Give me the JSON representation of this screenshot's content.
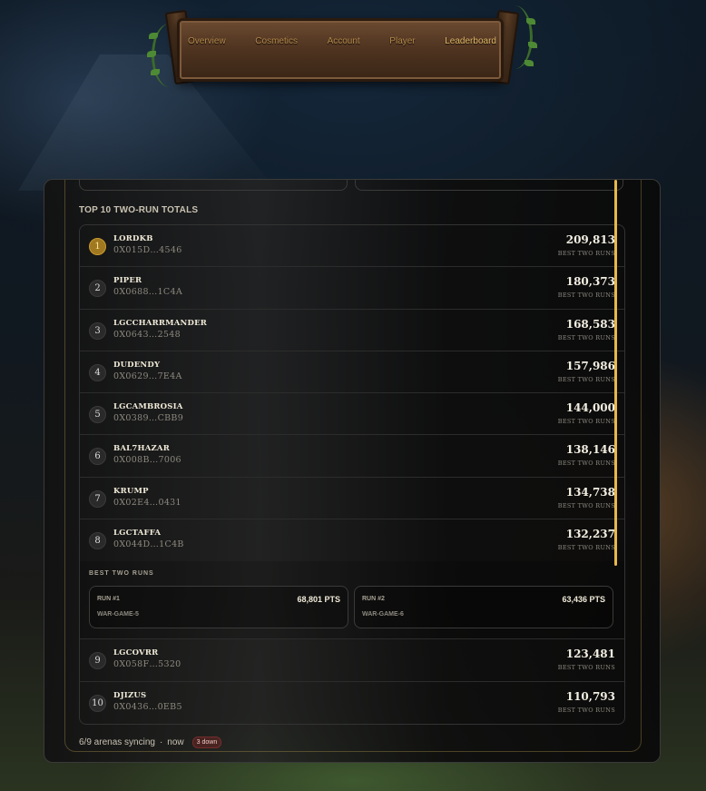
{
  "nav": {
    "items": [
      {
        "label": "Overview",
        "active": false
      },
      {
        "label": "Cosmetics",
        "active": false
      },
      {
        "label": "Account",
        "active": false
      },
      {
        "label": "Player",
        "active": false
      },
      {
        "label": "Leaderboard",
        "active": true
      }
    ]
  },
  "leaderboard": {
    "title": "TOP 10 TWO-RUN TOTALS",
    "caption": "BEST TWO RUNS",
    "rows_top": [
      {
        "rank": "1",
        "name": "LORDKB",
        "address": "0X015D…4546",
        "score": "209,813"
      },
      {
        "rank": "2",
        "name": "PIPER",
        "address": "0X0688…1C4A",
        "score": "180,373"
      },
      {
        "rank": "3",
        "name": "LGCCHARRMANDER",
        "address": "0X0643…2548",
        "score": "168,583"
      },
      {
        "rank": "4",
        "name": "DUDENDY",
        "address": "0X0629…7E4A",
        "score": "157,986"
      },
      {
        "rank": "5",
        "name": "LGCAMBROSIA",
        "address": "0X0389…CBB9",
        "score": "144,000"
      },
      {
        "rank": "6",
        "name": "BAL7HAZAR",
        "address": "0X008B…7006",
        "score": "138,146"
      },
      {
        "rank": "7",
        "name": "KRUMP",
        "address": "0X02E4…0431",
        "score": "134,738"
      },
      {
        "rank": "8",
        "name": "LGCTAFFA",
        "address": "0X044D…1C4B",
        "score": "132,237"
      }
    ],
    "expanded": {
      "title": "BEST TWO RUNS",
      "runs": [
        {
          "label": "RUN #1",
          "points": "68,801 PTS",
          "game": "WAR-GAME-5"
        },
        {
          "label": "RUN #2",
          "points": "63,436 PTS",
          "game": "WAR-GAME-6"
        }
      ]
    },
    "rows_bottom": [
      {
        "rank": "9",
        "name": "LGCOVRR",
        "address": "0X058F…5320",
        "score": "123,481"
      },
      {
        "rank": "10",
        "name": "DJIZUS",
        "address": "0X0436…0EB5",
        "score": "110,793"
      }
    ]
  },
  "footer": {
    "sync_text": "6/9 arenas syncing",
    "separator": "·",
    "time": "now",
    "down_badge": "3 down"
  },
  "colors": {
    "accent": "#e8b84a",
    "gold_rank": "#a07820",
    "nav_active": "#e2b866",
    "nav_inactive": "#b5894a"
  }
}
